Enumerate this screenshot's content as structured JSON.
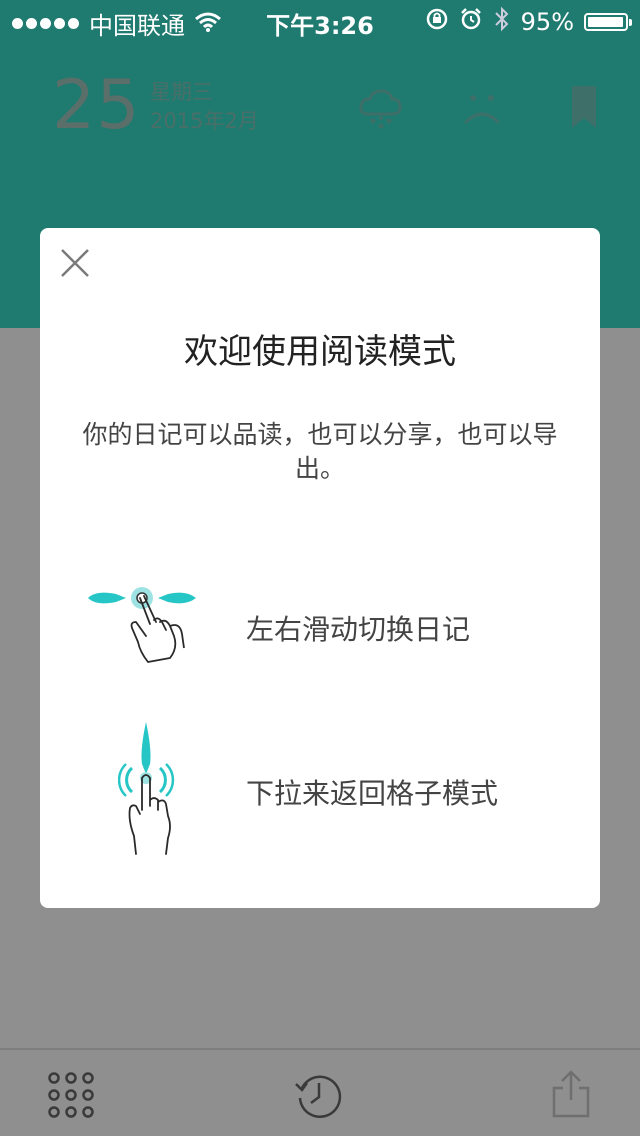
{
  "status_bar": {
    "carrier": "中国联通",
    "time": "下午3:26",
    "battery": "95%"
  },
  "header": {
    "day": "25",
    "weekday": "星期三",
    "month": "2015年2月",
    "icons": [
      "rain-cloud-icon",
      "sad-face-icon",
      "bookmark-icon"
    ]
  },
  "modal": {
    "title": "欢迎使用阅读模式",
    "description": "你的日记可以品读，也可以分享，也可以导出。",
    "gestures": [
      {
        "icon": "swipe-horizontal-icon",
        "label": "左右滑动切换日记"
      },
      {
        "icon": "pull-down-icon",
        "label": "下拉来返回格子模式"
      }
    ]
  },
  "toolbar": {
    "icons": [
      "grid-icon",
      "history-clock-icon",
      "share-icon"
    ]
  },
  "colors": {
    "teal": "#1f7a70",
    "accent": "#26c6c6",
    "dim_background": "#8f8f8f"
  }
}
